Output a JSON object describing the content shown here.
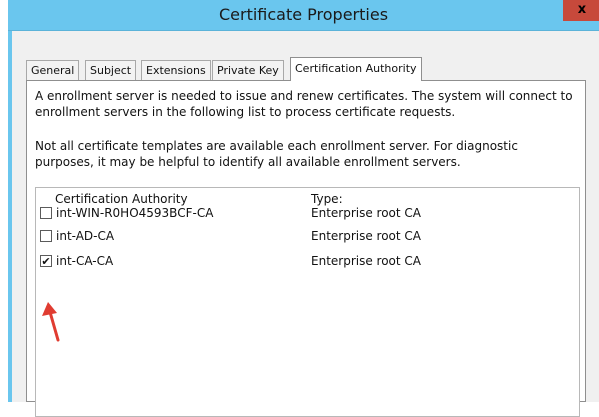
{
  "window": {
    "title": "Certificate Properties",
    "close_glyph": "x"
  },
  "tabs": [
    {
      "label": "General",
      "active": false
    },
    {
      "label": "Subject",
      "active": false
    },
    {
      "label": "Extensions",
      "active": false
    },
    {
      "label": "Private Key",
      "active": false
    },
    {
      "label": "Certification Authority",
      "active": true
    }
  ],
  "panel": {
    "paragraph1": "A enrollment server is needed to issue and renew certificates. The system will connect to enrollment servers in the following list to process certificate requests.",
    "paragraph2": "Not all certificate templates are available each enrollment server. For diagnostic purposes, it may be helpful to identify all available enrollment servers."
  },
  "list": {
    "col_ca": "Certification Authority",
    "col_type": "Type:",
    "rows": [
      {
        "name": "int-WIN-R0HO4593BCF-CA",
        "type": "Enterprise root CA",
        "checked": false
      },
      {
        "name": "int-AD-CA",
        "type": "Enterprise root CA",
        "checked": false
      },
      {
        "name": "int-CA-CA",
        "type": "Enterprise root CA",
        "checked": true
      }
    ]
  },
  "colors": {
    "titlebar": "#6ac6ee",
    "close": "#c7493b",
    "arrow": "#e03c31"
  },
  "icons": {
    "checkmark": "✔",
    "arrow": "annotation-arrow"
  }
}
